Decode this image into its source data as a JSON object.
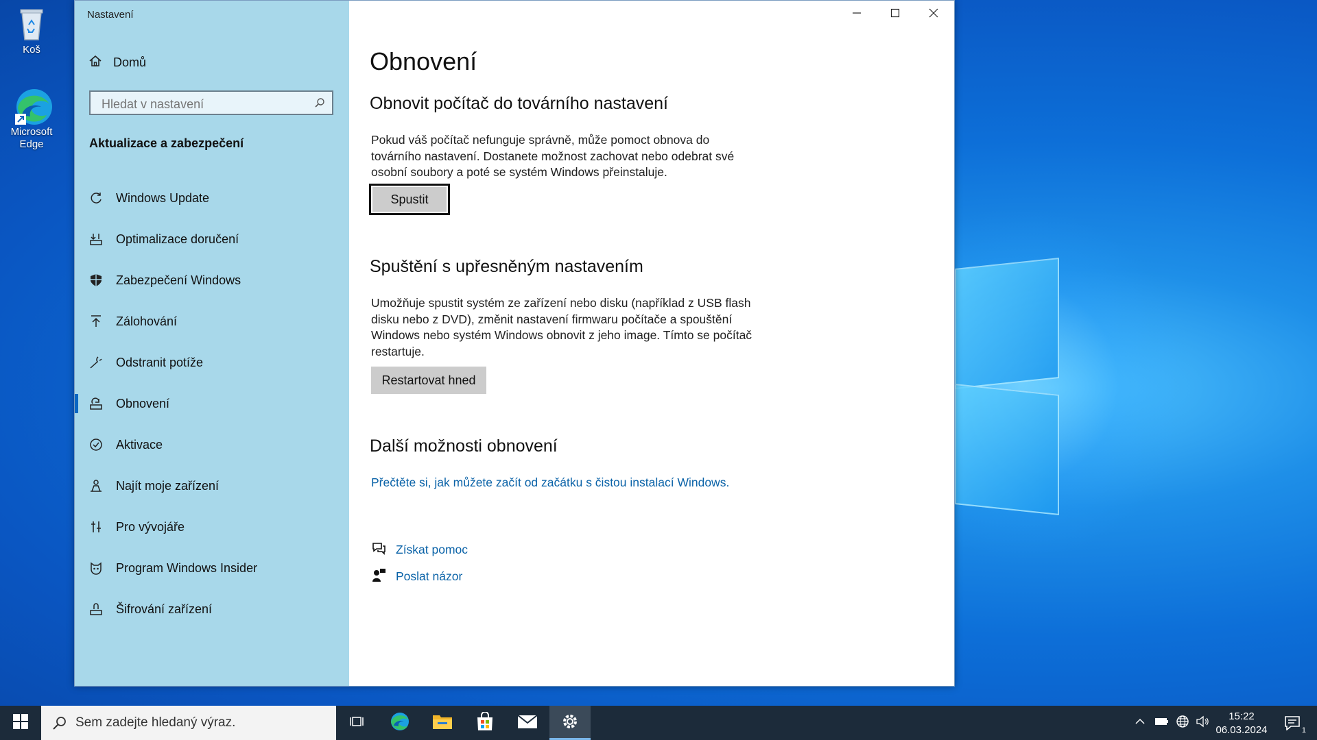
{
  "desktop": {
    "icons": [
      {
        "label": "Koš"
      },
      {
        "label": "Microsoft Edge"
      }
    ]
  },
  "window": {
    "title": "Nastavení",
    "controls": {
      "minimize": "minimize",
      "maximize": "maximize",
      "close": "close"
    }
  },
  "sidebar": {
    "home_label": "Domů",
    "search_placeholder": "Hledat v nastavení",
    "section_title": "Aktualizace a zabezpečení",
    "items": [
      {
        "label": "Windows Update",
        "icon": "refresh-icon"
      },
      {
        "label": "Optimalizace doručení",
        "icon": "delivery-icon"
      },
      {
        "label": "Zabezpečení Windows",
        "icon": "shield-icon"
      },
      {
        "label": "Zálohování",
        "icon": "backup-icon"
      },
      {
        "label": "Odstranit potíže",
        "icon": "wrench-icon"
      },
      {
        "label": "Obnovení",
        "icon": "recovery-icon",
        "active": true
      },
      {
        "label": "Aktivace",
        "icon": "check-circle-icon"
      },
      {
        "label": "Najít moje zařízení",
        "icon": "person-pin-icon"
      },
      {
        "label": "Pro vývojáře",
        "icon": "developer-icon"
      },
      {
        "label": "Program Windows Insider",
        "icon": "insider-icon"
      },
      {
        "label": "Šifrování zařízení",
        "icon": "encryption-icon"
      }
    ]
  },
  "main": {
    "page_title": "Obnovení",
    "reset": {
      "heading": "Obnovit počítač do továrního nastavení",
      "text": "Pokud váš počítač nefunguje správně, může pomoct obnova do továrního nastavení. Dostanete možnost zachovat nebo odebrat své osobní soubory a poté se systém Windows přeinstaluje.",
      "button": "Spustit"
    },
    "advanced": {
      "heading": "Spuštění s upřesněným nastavením",
      "text": "Umožňuje spustit systém ze zařízení nebo disku (například z USB flash disku nebo z DVD), změnit nastavení firmwaru počítače a spouštění Windows nebo systém Windows obnovit z jeho image. Tímto se počítač restartuje.",
      "button": "Restartovat hned"
    },
    "more": {
      "heading": "Další možnosti obnovení",
      "link": "Přečtěte si, jak můžete začít od začátku s čistou instalací Windows."
    },
    "help": {
      "get_help": "Získat pomoc",
      "feedback": "Poslat názor"
    }
  },
  "taskbar": {
    "search_placeholder": "Sem zadejte hledaný výraz.",
    "apps": [
      "task-view-icon",
      "edge-icon",
      "file-explorer-icon",
      "store-icon",
      "mail-icon",
      "settings-icon"
    ],
    "time": "15:22",
    "date": "06.03.2024",
    "notification_count": "1"
  },
  "colors": {
    "sidebar_bg": "#a8d8ea",
    "accent": "#0a66c2",
    "link": "#0b63a8",
    "taskbar": "#1c2b3a"
  }
}
